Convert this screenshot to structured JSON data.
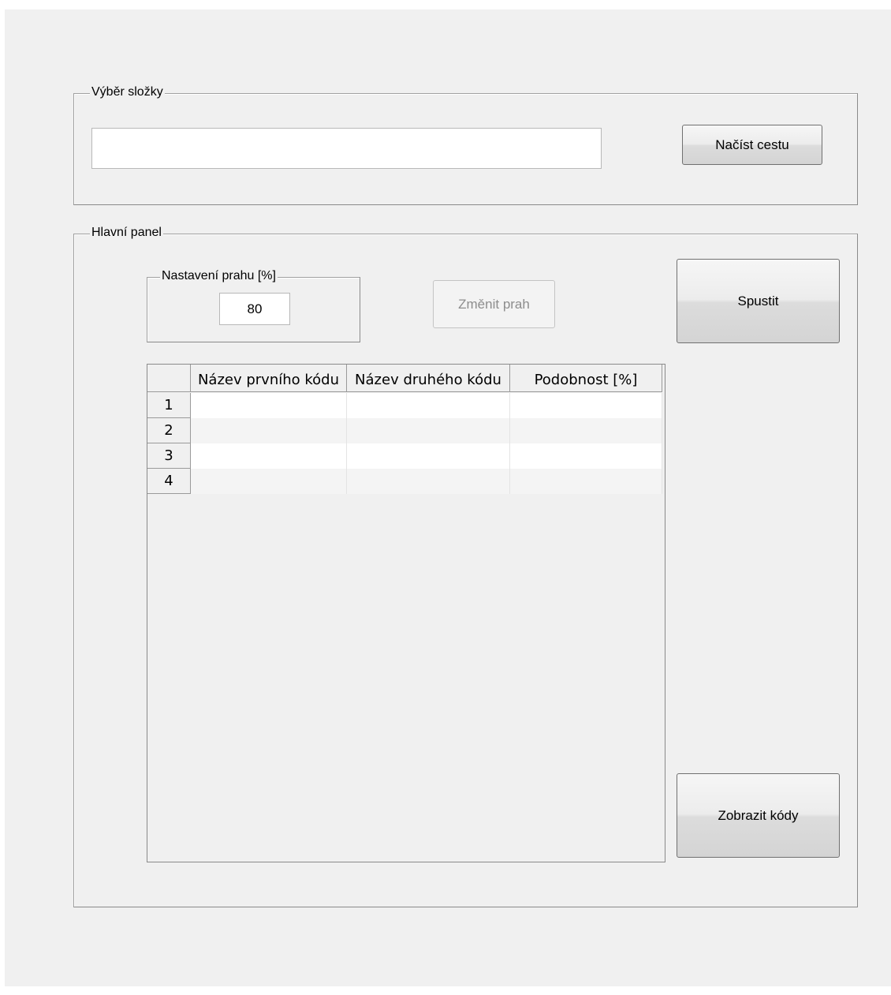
{
  "folder_panel": {
    "title": "Výběr složky",
    "path_value": "",
    "load_button": "Načíst cestu"
  },
  "main_panel": {
    "title": "Hlavní panel",
    "threshold": {
      "title": "Nastavení prahu [%]",
      "value": "80"
    },
    "change_threshold_button": "Změnit prah",
    "run_button": "Spustit",
    "show_codes_button": "Zobrazit kódy",
    "table": {
      "columns": [
        "Název prvního kódu",
        "Název druhého kódu",
        "Podobnost [%]"
      ],
      "rows": [
        {
          "index": "1",
          "cells": [
            "",
            "",
            ""
          ]
        },
        {
          "index": "2",
          "cells": [
            "",
            "",
            ""
          ]
        },
        {
          "index": "3",
          "cells": [
            "",
            "",
            ""
          ]
        },
        {
          "index": "4",
          "cells": [
            "",
            "",
            ""
          ]
        }
      ]
    }
  },
  "colors": {
    "background": "#f0f0f0",
    "row_even": "#ffffff",
    "row_odd": "#f4f4f4",
    "disabled_text": "#8d8d8d"
  }
}
